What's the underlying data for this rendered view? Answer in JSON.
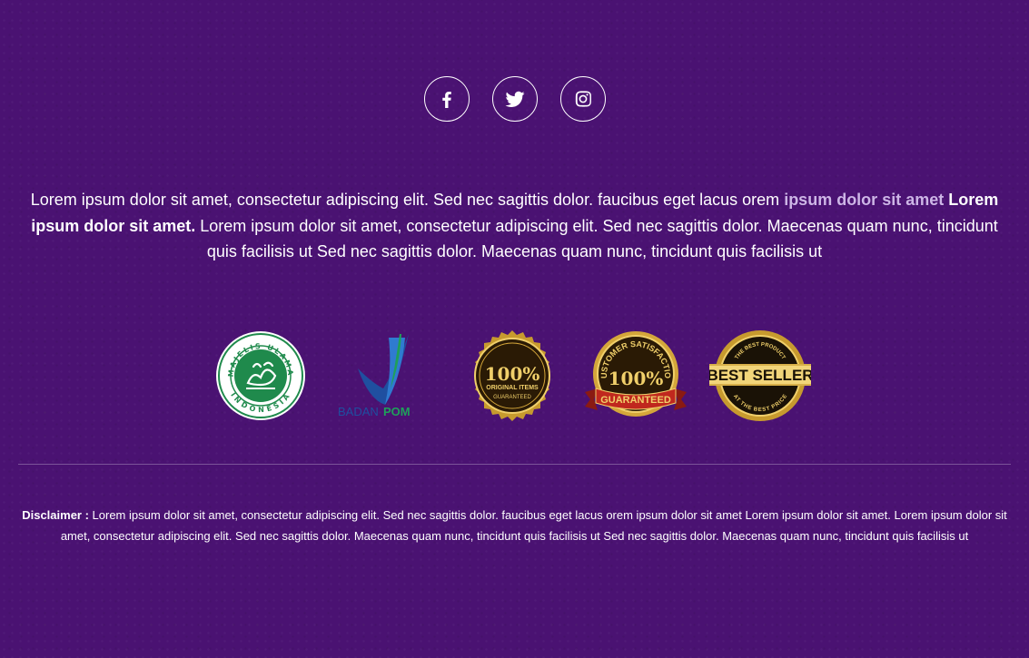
{
  "social": [
    {
      "name": "facebook",
      "icon": "facebook-icon"
    },
    {
      "name": "twitter",
      "icon": "twitter-icon"
    },
    {
      "name": "instagram",
      "icon": "instagram-icon"
    }
  ],
  "intro": {
    "part1": "Lorem ipsum dolor sit amet, consectetur adipiscing elit. Sed nec sagittis dolor.  faucibus eget lacus orem ",
    "highlight": "ipsum dolor sit amet",
    "bold": " Lorem ipsum dolor sit amet.",
    "part2": " Lorem ipsum dolor sit amet, consectetur adipiscing elit. Sed nec sagittis dolor. Maecenas quam nunc, tincidunt quis facilisis ut Sed nec sagittis dolor. Maecenas quam nunc, tincidunt quis facilisis ut"
  },
  "badges": {
    "mui": {
      "top": "MAJELIS ULAMA",
      "bottom": "INDONESIA"
    },
    "bpom": {
      "word1": "BADAN",
      "word2": "POM"
    },
    "original": {
      "big": "100%",
      "line1": "ORIGINAL ITEMS",
      "line2": "GUARANTEED"
    },
    "satisfaction": {
      "arc": "CUSTOMER SATISFACTION",
      "big": "100%",
      "ribbon": "GUARANTEED"
    },
    "bestseller": {
      "top": "THE BEST PRODUCT",
      "big": "BEST SELLER",
      "bottom": "AT THE BEST PRICE"
    }
  },
  "disclaimer": {
    "label": "Disclaimer :",
    "text": " Lorem ipsum dolor sit amet, consectetur adipiscing elit. Sed nec sagittis dolor.  faucibus eget lacus orem ipsum dolor sit amet Lorem ipsum dolor sit amet. Lorem ipsum dolor sit amet, consectetur adipiscing elit. Sed nec sagittis dolor. Maecenas quam nunc, tincidunt quis facilisis ut Sed nec sagittis dolor. Maecenas quam nunc, tincidunt quis facilisis ut"
  },
  "colors": {
    "background": "#4a1272",
    "highlight": "#cdb6e6",
    "mui_green": "#1f8a4c",
    "gold": "#d4a63a",
    "ribbon_red": "#c0281e",
    "bpom_blue": "#1f4fa0"
  }
}
